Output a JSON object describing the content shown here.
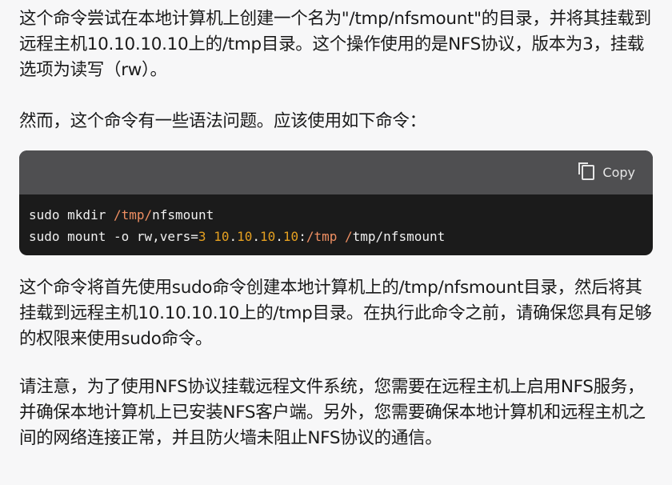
{
  "paragraphs": [
    "这个命令尝试在本地计算机上创建一个名为\"/tmp/nfsmount\"的目录，并将其挂载到远程主机10.10.10.10上的/tmp目录。这个操作使用的是NFS协议，版本为3，挂载选项为读写（rw）。",
    "然而，这个命令有一些语法问题。应该使用如下命令：",
    "这个命令将首先使用sudo命令创建本地计算机上的/tmp/nfsmount目录，然后将其挂载到远程主机10.10.10.10上的/tmp目录。在执行此命令之前，请确保您具有足够的权限来使用sudo命令。",
    "请注意，为了使用NFS协议挂载远程文件系统，您需要在远程主机上启用NFS服务，并确保本地计算机上已安装NFS客户端。另外，您需要确保本地计算机和远程主机之间的网络连接正常，并且防火墙未阻止NFS协议的通信。"
  ],
  "code": {
    "copy_label": "Copy",
    "lines": [
      [
        [
          "sudo mkdir ",
          ""
        ],
        [
          "/tmp/",
          "path"
        ],
        [
          "nfsmount",
          ""
        ]
      ],
      [
        [
          "sudo mount -o rw,vers=",
          ""
        ],
        [
          "3",
          "num"
        ],
        [
          " ",
          ""
        ],
        [
          "10",
          "num"
        ],
        [
          ".",
          ""
        ],
        [
          "10",
          "num"
        ],
        [
          ".",
          ""
        ],
        [
          "10",
          "num"
        ],
        [
          ".",
          ""
        ],
        [
          "10",
          "num"
        ],
        [
          ":",
          ""
        ],
        [
          "/tmp",
          "path"
        ],
        [
          " ",
          ""
        ],
        [
          "/",
          "path"
        ],
        [
          "tmp/nfsmount",
          ""
        ]
      ]
    ]
  },
  "colors": {
    "path": "#ef8f62",
    "num": "#e5a020",
    "code_bg": "#1b1b1b",
    "code_header": "#4f4f51"
  }
}
